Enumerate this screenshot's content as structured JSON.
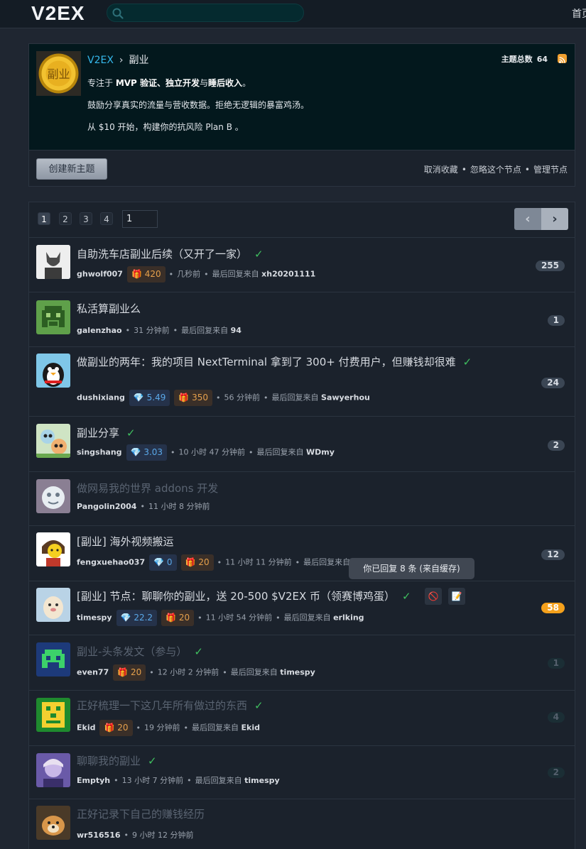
{
  "header": {
    "logo": "V2EX",
    "nav_home": "首页"
  },
  "node": {
    "breadcrumb_home": "V2EX",
    "breadcrumb_sep": "›",
    "breadcrumb_current": "副业",
    "topic_count_label": "主题总数",
    "topic_count": "64",
    "avatar_text": "副业",
    "desc1_pre": "专注于 ",
    "desc1_bold": "MVP 验证、独立开发",
    "desc1_mid": "与",
    "desc1_bold2": "睡后收入",
    "desc1_end": "。",
    "desc2": "鼓励分享真实的流量与营收数据。拒绝无逻辑的暴富鸡汤。",
    "desc3": "从 $10 开始，构建你的抗风险 Plan B 。",
    "create_button": "创建新主题",
    "actions": [
      "取消收藏",
      "忽略这个节点",
      "管理节点"
    ],
    "actions_sep": "•"
  },
  "pager": {
    "pages": [
      "1",
      "2",
      "3",
      "4"
    ],
    "current_input": "1",
    "prev": "‹",
    "next": "›"
  },
  "topics": [
    {
      "title": "自助洗车店副业后续（又开了一家）",
      "check": "✓",
      "user": "ghwolf007",
      "gift": "420",
      "time": "几秒前",
      "last_label": "最后回复来自",
      "last_user": "xh20201111",
      "replies": "255"
    },
    {
      "title": "私活算副业么",
      "user": "galenzhao",
      "time": "31 分钟前",
      "last_label": "最后回复来自",
      "last_user": "94",
      "replies": "1"
    },
    {
      "title": "做副业的两年：我的项目 NextTerminal 拿到了 300+ 付费用户，但赚钱却很难",
      "check": "✓",
      "user": "dushixiang",
      "gem": "5.49",
      "gift": "350",
      "time": "56 分钟前",
      "last_label": "最后回复来自",
      "last_user": "Sawyerhou",
      "replies": "24"
    },
    {
      "title": "副业分享",
      "check": "✓",
      "user": "singshang",
      "gem": "3.03",
      "time": "10 小时 47 分钟前",
      "last_label": "最后回复来自",
      "last_user": "WDmy",
      "replies": "2"
    },
    {
      "title": "做网易我的世界 addons 开发",
      "user": "Pangolin2004",
      "time": "11 小时 8 分钟前"
    },
    {
      "title": "[副业] 海外视频搬运",
      "user": "fengxuehao037",
      "gem": "0",
      "gift": "20",
      "time": "11 小时 11 分钟前",
      "last_label": "最后回复来自",
      "replies": "12"
    },
    {
      "title": "[副业] 节点：聊聊你的副业，送 20-500 $V2EX 币（领赛博鸡蛋）",
      "check": "✓",
      "user": "timespy",
      "gem": "22.2",
      "gift": "20",
      "time": "11 小时 54 分钟前",
      "last_label": "最后回复来自",
      "last_user": "erlking",
      "replies": "58"
    },
    {
      "title": "副业-头条发文（参与）",
      "check": "✓",
      "user": "even77",
      "gift": "20",
      "time": "12 小时 2 分钟前",
      "last_label": "最后回复来自",
      "last_user": "timespy",
      "replies": "1"
    },
    {
      "title": "正好梳理一下这几年所有做过的东西",
      "check": "✓",
      "user": "Ekid",
      "gift": "20",
      "time": "19 分钟前",
      "last_label": "最后回复来自",
      "last_user": "Ekid",
      "replies": "4"
    },
    {
      "title": "聊聊我的副业",
      "check": "✓",
      "user": "Emptyh",
      "time": "13 小时 7 分钟前",
      "last_label": "最后回复来自",
      "last_user": "timespy",
      "replies": "2"
    },
    {
      "title": "正好记录下自己的赚钱经历",
      "user": "wr516516",
      "time": "9 小时 12 分钟前"
    }
  ],
  "tooltip": "你已回复 8 条 (来自缓存)",
  "icons": {
    "gift": "🎁",
    "gem": "💎",
    "block": "🚫",
    "note": "📝"
  },
  "colors": {
    "link": "#35b8ec",
    "check": "#3fbf5f",
    "hot_count": "#f5a11c",
    "gift": "#e5a04c",
    "gem": "#5aa8e8"
  }
}
